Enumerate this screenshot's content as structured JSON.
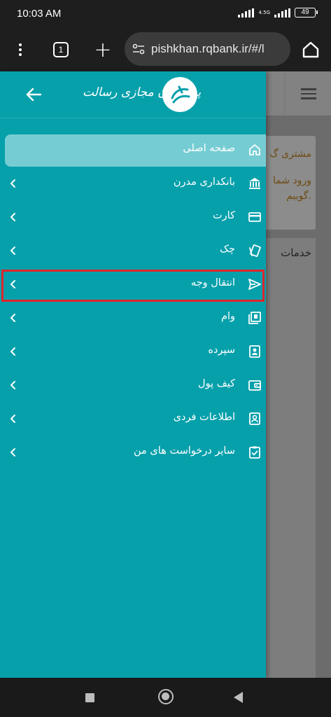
{
  "status_bar": {
    "time": "10:03 AM",
    "network": "4.5G",
    "battery": "49"
  },
  "browser": {
    "tab_count": "1",
    "url": "pishkhan.rqbank.ir/#/l"
  },
  "page_behind": {
    "card_line1": "مشتری گ",
    "card_line2": "ورود شما",
    "card_line3": "گوییم.",
    "services_heading": "خدمات"
  },
  "drawer": {
    "brand": "پیشخوان مجازی رسالت",
    "items": [
      {
        "label": "صفحه اصلی",
        "icon": "home-icon",
        "active": true
      },
      {
        "label": "بانکداری مدرن",
        "icon": "bank-icon"
      },
      {
        "label": "کارت",
        "icon": "card-icon"
      },
      {
        "label": "چک",
        "icon": "cheque-icon"
      },
      {
        "label": "انتقال وجه",
        "icon": "send-icon",
        "highlighted": true
      },
      {
        "label": "وام",
        "icon": "loan-icon"
      },
      {
        "label": "سپرده",
        "icon": "deposit-icon"
      },
      {
        "label": "کیف پول",
        "icon": "wallet-icon"
      },
      {
        "label": "اطلاعات فردی",
        "icon": "profile-icon"
      },
      {
        "label": "سایر درخواست های من",
        "icon": "requests-icon"
      }
    ],
    "colors": {
      "background": "#06a0ab",
      "active_item": "#75cdd3",
      "highlight_border": "#e0252c"
    }
  }
}
